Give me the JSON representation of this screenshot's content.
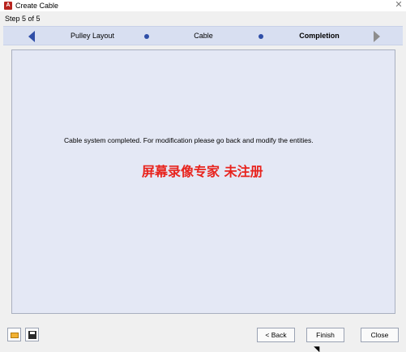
{
  "window": {
    "title": "Create Cable",
    "step": "Step 5 of 5"
  },
  "nav": {
    "steps": [
      "Pulley Layout",
      "Cable",
      "Completion"
    ],
    "active_step": "Completion"
  },
  "content": {
    "message": "Cable system completed. For modification please go back and modify the entities.",
    "watermark": "屏幕录像专家 未注册"
  },
  "footer": {
    "back_label": "< Back",
    "finish_label": "Finish",
    "close_label": "Close"
  },
  "colors": {
    "nav_background": "#d8dff1",
    "panel_background": "#e4e8f5",
    "watermark": "#e8241e",
    "accent": "#2f4ea7"
  },
  "icons": [
    "app-icon",
    "close-icon",
    "nav-left-arrow-icon",
    "nav-right-arrow-icon",
    "open-folder-icon",
    "save-icon"
  ]
}
